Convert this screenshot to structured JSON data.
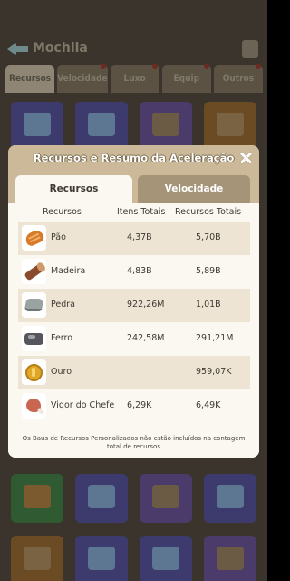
{
  "background": {
    "title": "Mochila",
    "tabs": [
      {
        "label": "Recursos",
        "active": true,
        "badge": false
      },
      {
        "label": "Velocidade",
        "active": false,
        "badge": true
      },
      {
        "label": "Luxo",
        "active": false,
        "badge": true
      },
      {
        "label": "Equip",
        "active": false,
        "badge": true
      },
      {
        "label": "Outros",
        "active": false,
        "badge": true
      }
    ]
  },
  "modal": {
    "title": "Recursos e Resumo da Aceleração",
    "tabs": {
      "recursos": "Recursos",
      "velocidade": "Velocidade"
    },
    "columns": {
      "resource": "Recursos",
      "items_total": "Itens Totais",
      "resources_total": "Recursos Totais"
    },
    "rows": [
      {
        "icon": "bread-icon",
        "name": "Pão",
        "items": "4,37B",
        "total": "5,70B"
      },
      {
        "icon": "wood-icon",
        "name": "Madeira",
        "items": "4,83B",
        "total": "5,89B"
      },
      {
        "icon": "stone-icon",
        "name": "Pedra",
        "items": "922,26M",
        "total": "1,01B"
      },
      {
        "icon": "iron-icon",
        "name": "Ferro",
        "items": "242,58M",
        "total": "291,21M"
      },
      {
        "icon": "gold-coin-icon",
        "name": "Ouro",
        "items": "",
        "total": "959,07K"
      },
      {
        "icon": "meat-icon",
        "name": "Vigor do Chefe",
        "items": "6,29K",
        "total": "6,49K"
      }
    ],
    "footnote": "Os Baús de Recursos Personalizados não estão incluídos na contagem total de recursos"
  },
  "colors": {
    "header_bg": "#cbb999",
    "panel_bg": "#fbf8f1",
    "row_stripe": "#eee4d3",
    "inactive_tab": "#a69479"
  }
}
